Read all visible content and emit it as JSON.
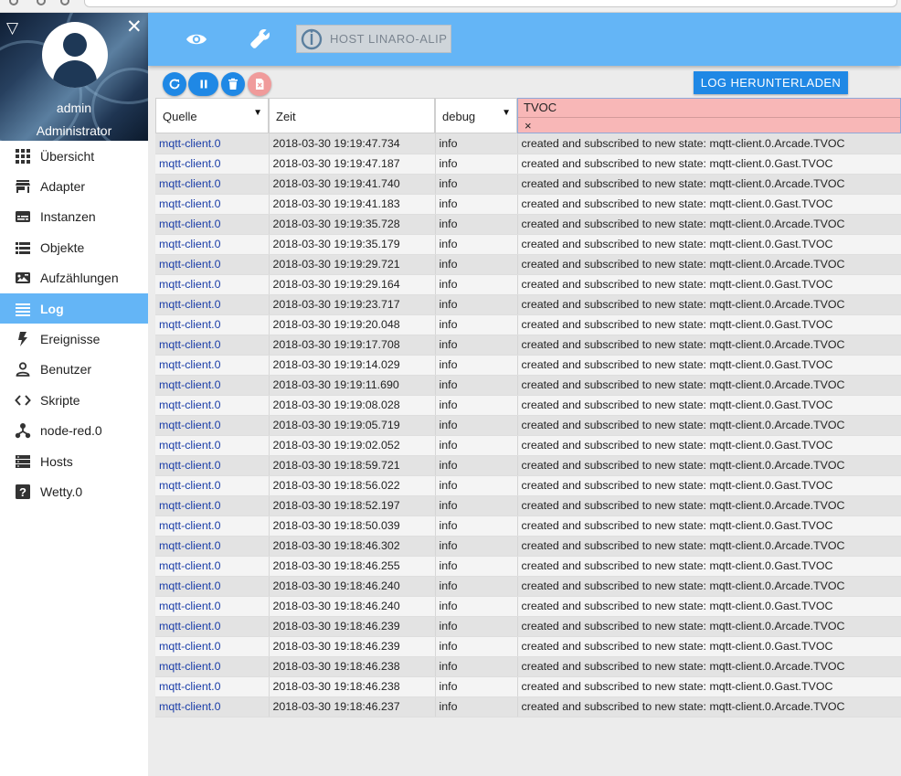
{
  "sidebar": {
    "user_name": "admin",
    "user_role": "Administrator",
    "items": [
      {
        "label": "Übersicht",
        "icon": "apps-grid-icon",
        "active": false
      },
      {
        "label": "Adapter",
        "icon": "store-icon",
        "active": false
      },
      {
        "label": "Instanzen",
        "icon": "subtitles-icon",
        "active": false
      },
      {
        "label": "Objekte",
        "icon": "list-icon",
        "active": false
      },
      {
        "label": "Aufzählungen",
        "icon": "photo-album-icon",
        "active": false
      },
      {
        "label": "Log",
        "icon": "lines-icon",
        "active": true
      },
      {
        "label": "Ereignisse",
        "icon": "flash-icon",
        "active": false
      },
      {
        "label": "Benutzer",
        "icon": "person-outline-icon",
        "active": false
      },
      {
        "label": "Skripte",
        "icon": "code-icon",
        "active": false
      },
      {
        "label": "node-red.0",
        "icon": "nodes-icon",
        "active": false
      },
      {
        "label": "Hosts",
        "icon": "storage-icon",
        "active": false
      },
      {
        "label": "Wetty.0",
        "icon": "help-icon",
        "active": false
      }
    ]
  },
  "topbar": {
    "host_label": "HOST LINARO-ALIP"
  },
  "toolbar": {
    "download_label": "LOG HERUNTERLADEN"
  },
  "filters": {
    "source": "Quelle",
    "time": "Zeit",
    "level": "debug",
    "message": "TVOC",
    "clear": "×"
  },
  "log": [
    {
      "source": "mqtt-client.0",
      "time": "2018-03-30 19:19:47.734",
      "level": "info",
      "message": "created and subscribed to new state: mqtt-client.0.Arcade.TVOC"
    },
    {
      "source": "mqtt-client.0",
      "time": "2018-03-30 19:19:47.187",
      "level": "info",
      "message": "created and subscribed to new state: mqtt-client.0.Gast.TVOC"
    },
    {
      "source": "mqtt-client.0",
      "time": "2018-03-30 19:19:41.740",
      "level": "info",
      "message": "created and subscribed to new state: mqtt-client.0.Arcade.TVOC"
    },
    {
      "source": "mqtt-client.0",
      "time": "2018-03-30 19:19:41.183",
      "level": "info",
      "message": "created and subscribed to new state: mqtt-client.0.Gast.TVOC"
    },
    {
      "source": "mqtt-client.0",
      "time": "2018-03-30 19:19:35.728",
      "level": "info",
      "message": "created and subscribed to new state: mqtt-client.0.Arcade.TVOC"
    },
    {
      "source": "mqtt-client.0",
      "time": "2018-03-30 19:19:35.179",
      "level": "info",
      "message": "created and subscribed to new state: mqtt-client.0.Gast.TVOC"
    },
    {
      "source": "mqtt-client.0",
      "time": "2018-03-30 19:19:29.721",
      "level": "info",
      "message": "created and subscribed to new state: mqtt-client.0.Arcade.TVOC"
    },
    {
      "source": "mqtt-client.0",
      "time": "2018-03-30 19:19:29.164",
      "level": "info",
      "message": "created and subscribed to new state: mqtt-client.0.Gast.TVOC"
    },
    {
      "source": "mqtt-client.0",
      "time": "2018-03-30 19:19:23.717",
      "level": "info",
      "message": "created and subscribed to new state: mqtt-client.0.Arcade.TVOC"
    },
    {
      "source": "mqtt-client.0",
      "time": "2018-03-30 19:19:20.048",
      "level": "info",
      "message": "created and subscribed to new state: mqtt-client.0.Gast.TVOC"
    },
    {
      "source": "mqtt-client.0",
      "time": "2018-03-30 19:19:17.708",
      "level": "info",
      "message": "created and subscribed to new state: mqtt-client.0.Arcade.TVOC"
    },
    {
      "source": "mqtt-client.0",
      "time": "2018-03-30 19:19:14.029",
      "level": "info",
      "message": "created and subscribed to new state: mqtt-client.0.Gast.TVOC"
    },
    {
      "source": "mqtt-client.0",
      "time": "2018-03-30 19:19:11.690",
      "level": "info",
      "message": "created and subscribed to new state: mqtt-client.0.Arcade.TVOC"
    },
    {
      "source": "mqtt-client.0",
      "time": "2018-03-30 19:19:08.028",
      "level": "info",
      "message": "created and subscribed to new state: mqtt-client.0.Gast.TVOC"
    },
    {
      "source": "mqtt-client.0",
      "time": "2018-03-30 19:19:05.719",
      "level": "info",
      "message": "created and subscribed to new state: mqtt-client.0.Arcade.TVOC"
    },
    {
      "source": "mqtt-client.0",
      "time": "2018-03-30 19:19:02.052",
      "level": "info",
      "message": "created and subscribed to new state: mqtt-client.0.Gast.TVOC"
    },
    {
      "source": "mqtt-client.0",
      "time": "2018-03-30 19:18:59.721",
      "level": "info",
      "message": "created and subscribed to new state: mqtt-client.0.Arcade.TVOC"
    },
    {
      "source": "mqtt-client.0",
      "time": "2018-03-30 19:18:56.022",
      "level": "info",
      "message": "created and subscribed to new state: mqtt-client.0.Gast.TVOC"
    },
    {
      "source": "mqtt-client.0",
      "time": "2018-03-30 19:18:52.197",
      "level": "info",
      "message": "created and subscribed to new state: mqtt-client.0.Arcade.TVOC"
    },
    {
      "source": "mqtt-client.0",
      "time": "2018-03-30 19:18:50.039",
      "level": "info",
      "message": "created and subscribed to new state: mqtt-client.0.Gast.TVOC"
    },
    {
      "source": "mqtt-client.0",
      "time": "2018-03-30 19:18:46.302",
      "level": "info",
      "message": "created and subscribed to new state: mqtt-client.0.Arcade.TVOC"
    },
    {
      "source": "mqtt-client.0",
      "time": "2018-03-30 19:18:46.255",
      "level": "info",
      "message": "created and subscribed to new state: mqtt-client.0.Gast.TVOC"
    },
    {
      "source": "mqtt-client.0",
      "time": "2018-03-30 19:18:46.240",
      "level": "info",
      "message": "created and subscribed to new state: mqtt-client.0.Arcade.TVOC"
    },
    {
      "source": "mqtt-client.0",
      "time": "2018-03-30 19:18:46.240",
      "level": "info",
      "message": "created and subscribed to new state: mqtt-client.0.Gast.TVOC"
    },
    {
      "source": "mqtt-client.0",
      "time": "2018-03-30 19:18:46.239",
      "level": "info",
      "message": "created and subscribed to new state: mqtt-client.0.Arcade.TVOC"
    },
    {
      "source": "mqtt-client.0",
      "time": "2018-03-30 19:18:46.239",
      "level": "info",
      "message": "created and subscribed to new state: mqtt-client.0.Gast.TVOC"
    },
    {
      "source": "mqtt-client.0",
      "time": "2018-03-30 19:18:46.238",
      "level": "info",
      "message": "created and subscribed to new state: mqtt-client.0.Arcade.TVOC"
    },
    {
      "source": "mqtt-client.0",
      "time": "2018-03-30 19:18:46.238",
      "level": "info",
      "message": "created and subscribed to new state: mqtt-client.0.Gast.TVOC"
    },
    {
      "source": "mqtt-client.0",
      "time": "2018-03-30 19:18:46.237",
      "level": "info",
      "message": "created and subscribed to new state: mqtt-client.0.Arcade.TVOC"
    }
  ],
  "colors": {
    "accent": "#64b5f6",
    "button": "#1f88e5",
    "disabled_button": "#f09b9b",
    "message_filter_bg": "#f8b7b7",
    "source_text": "#1a3da8"
  }
}
